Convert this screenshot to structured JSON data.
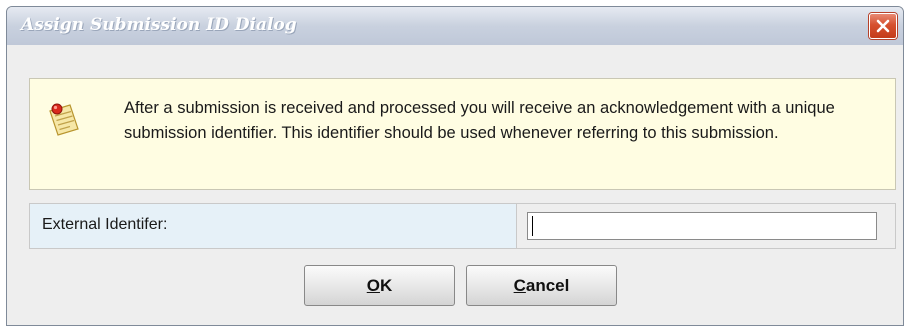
{
  "window": {
    "title": "Assign Submission ID Dialog",
    "close_icon": "close-icon"
  },
  "info": {
    "icon": "note-pin-icon",
    "message": "After a submission is received and processed you will receive an acknowledgement with a unique submission identifier. This identifier should be used whenever referring to this submission."
  },
  "form": {
    "label": "External Identifer:",
    "value": "",
    "placeholder": ""
  },
  "buttons": {
    "ok": {
      "mnemonic": "O",
      "rest": "K"
    },
    "cancel": {
      "mnemonic": "C",
      "rest": "ancel"
    }
  },
  "colors": {
    "info_background": "#fffde2",
    "label_background": "#e6f1f8",
    "close_button": "#d6512f"
  }
}
